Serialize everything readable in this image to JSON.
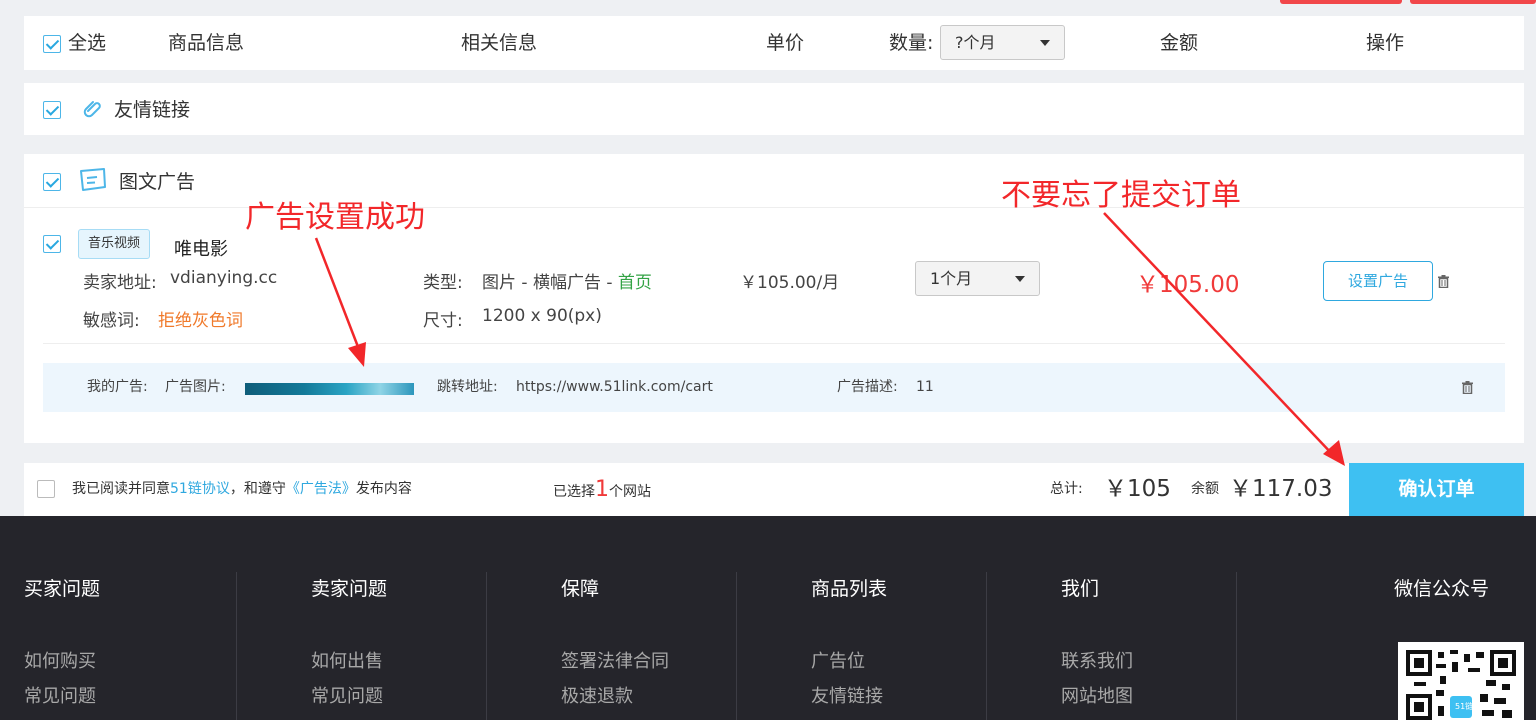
{
  "header": {
    "select_all": "全选",
    "product_info": "商品信息",
    "related_info": "相关信息",
    "unit_price": "单价",
    "quantity_label": "数量:",
    "quantity_value": "?个月",
    "amount": "金额",
    "operation": "操作"
  },
  "categories": {
    "friend_links": "友情链接",
    "image_text_ads": "图文广告"
  },
  "item": {
    "tag": "音乐视频",
    "name": "唯电影",
    "seller_label": "卖家地址:",
    "seller_value": "vdianying.cc",
    "sensitive_label": "敏感词:",
    "sensitive_value": "拒绝灰色词",
    "type_label": "类型:",
    "type_value": "图片 - 横幅广告 - ",
    "type_page": "首页",
    "size_label": "尺寸:",
    "size_value": "1200 x 90(px)",
    "unit_price": "￥105.00/月",
    "quantity": "1个月",
    "total": "￥105.00",
    "set_ad_button": "设置广告"
  },
  "my_ad": {
    "label": "我的广告:",
    "image_label": "广告图片:",
    "url_label": "跳转地址:",
    "url_value": "https://www.51link.com/cart",
    "desc_label": "广告描述:",
    "desc_value": "11"
  },
  "bottom": {
    "agree_prefix": "我已阅读并同意",
    "agreement": "51链协议",
    "comply": "，和遵守",
    "ad_law": "《广告法》",
    "publish": "发布内容",
    "selected_prefix": "已选择",
    "selected_count": "1",
    "selected_suffix": "个网站",
    "total_label": "总计:",
    "total_value": "￥105",
    "balance_label": "余额",
    "balance_value": "￥117.03",
    "confirm_button": "确认订单"
  },
  "footer": {
    "columns": [
      {
        "title": "买家问题",
        "links": [
          "如何购买",
          "常见问题"
        ]
      },
      {
        "title": "卖家问题",
        "links": [
          "如何出售",
          "常见问题"
        ]
      },
      {
        "title": "保障",
        "links": [
          "签署法律合同",
          "极速退款"
        ]
      },
      {
        "title": "商品列表",
        "links": [
          "广告位",
          "友情链接"
        ]
      },
      {
        "title": "我们",
        "links": [
          "联系我们",
          "网站地图"
        ]
      }
    ],
    "wechat_title": "微信公众号",
    "qr_badge": "51链"
  },
  "annotations": {
    "ad_success": "广告设置成功",
    "dont_forget": "不要忘了提交订单"
  },
  "colors": {
    "accent_blue": "#2fa8df",
    "confirm_button": "#3ec0f2",
    "price_red": "#f03a3a",
    "annotation_red": "#f2272a",
    "footer_bg": "#25252b"
  }
}
